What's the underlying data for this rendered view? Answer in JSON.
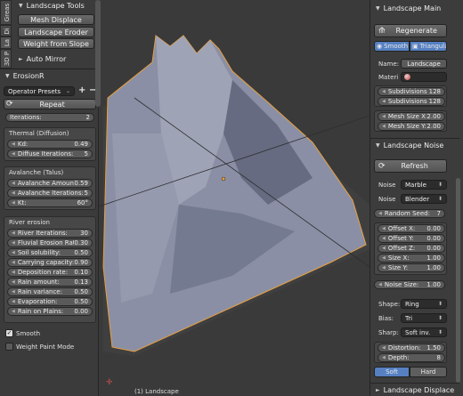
{
  "left_tabs": [
    "Greas",
    "Di",
    "La",
    "3D P"
  ],
  "landscape_tools": {
    "title": "Landscape Tools",
    "buttons": [
      "Mesh Displace",
      "Landscape Eroder",
      "Weight from Slope"
    ],
    "auto_mirror": "Auto Mirror"
  },
  "erosion": {
    "title": "ErosionR",
    "presets_label": "Operator Presets",
    "repeat_label": "Repeat",
    "iterations_label": "Iterations:",
    "iterations_value": "2",
    "thermal": {
      "title": "Thermal (Diffusion)",
      "fields": [
        {
          "label": "Kd:",
          "value": "0.49"
        },
        {
          "label": "Diffuse Iterations:",
          "value": "5"
        }
      ]
    },
    "avalanche": {
      "title": "Avalanche (Talus)",
      "fields": [
        {
          "label": "Avalanche Amount:",
          "value": "0.59"
        },
        {
          "label": "Avalanche Iterations:",
          "value": "5"
        },
        {
          "label": "Kt:",
          "value": "60°"
        }
      ]
    },
    "river": {
      "title": "River erosion",
      "fields": [
        {
          "label": "River Iterations:",
          "value": "30"
        },
        {
          "label": "Fluvial Erosion Rate:",
          "value": "0.30"
        },
        {
          "label": "Soil solubility:",
          "value": "0.50"
        },
        {
          "label": "Carrying capacity:",
          "value": "0.90"
        },
        {
          "label": "Deposition rate:",
          "value": "0.10"
        },
        {
          "label": "Rain amount:",
          "value": "0.13"
        },
        {
          "label": "Rain variance:",
          "value": "0.50"
        },
        {
          "label": "Evaporation:",
          "value": "0.50"
        },
        {
          "label": "Rain on Plains:",
          "value": "0.00"
        }
      ]
    },
    "smooth_label": "Smooth",
    "weight_paint_label": "Weight Paint Mode"
  },
  "viewport": {
    "object_label": "(1) Landscape"
  },
  "landscape_main": {
    "title": "Landscape Main",
    "regenerate": "Regenerate",
    "smooth": "Smooth",
    "triangular": "Triangular",
    "name_label": "Name:",
    "name_value": "Landscape",
    "material_label": "Materi",
    "subdivisions": [
      {
        "label": "Subdivisions X:",
        "value": "128"
      },
      {
        "label": "Subdivisions Y:",
        "value": "128"
      }
    ],
    "mesh_size": [
      {
        "label": "Mesh Size X:",
        "value": "2.00"
      },
      {
        "label": "Mesh Size Y:",
        "value": "2.00"
      }
    ]
  },
  "landscape_noise": {
    "title": "Landscape Noise",
    "refresh": "Refresh",
    "noise1_label": "Noise",
    "noise1_value": "Marble",
    "noise2_label": "Noise",
    "noise2_value": "Blender",
    "random_seed_label": "Random Seed:",
    "random_seed_value": "7",
    "offsets": [
      {
        "label": "Offset X:",
        "value": "0.00"
      },
      {
        "label": "Offset Y:",
        "value": "0.00"
      },
      {
        "label": "Offset Z:",
        "value": "0.00"
      },
      {
        "label": "Size X:",
        "value": "1.00"
      },
      {
        "label": "Size Y:",
        "value": "1.00"
      }
    ],
    "noise_size_label": "Noise Size:",
    "noise_size_value": "1.00",
    "shape_label": "Shape:",
    "shape_value": "Ring",
    "bias_label": "Bias:",
    "bias_value": "Tri",
    "sharp_label": "Sharp:",
    "sharp_value": "Soft inv.",
    "distortion_label": "Distortion:",
    "distortion_value": "1.50",
    "depth_label": "Depth:",
    "depth_value": "8",
    "soft": "Soft",
    "hard": "Hard"
  },
  "landscape_displace": {
    "title": "Landscape Displace"
  },
  "colors": {
    "accent": "#5680c2",
    "wire": "#e8a040"
  }
}
